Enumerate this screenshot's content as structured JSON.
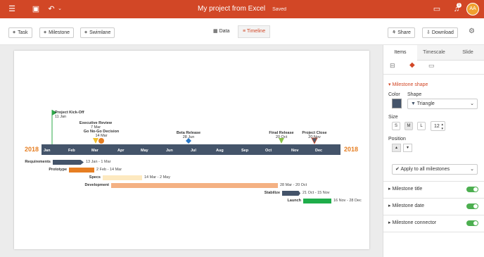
{
  "app": {
    "title": "My project from Excel",
    "status": "Saved",
    "avatar": "AA",
    "notifications": "1"
  },
  "toolbar": {
    "task": "Task",
    "milestone": "Milestone",
    "swimlane": "Swimlane",
    "data": "Data",
    "timeline": "Timeline",
    "share": "Share",
    "download": "Download"
  },
  "timeline": {
    "year_left": "2018",
    "year_right": "2018",
    "months": [
      "Jan",
      "Feb",
      "Mar",
      "Apr",
      "May",
      "Jun",
      "Jul",
      "Aug",
      "Sep",
      "Oct",
      "Nov",
      "Dec"
    ],
    "milestones": [
      {
        "name": "Project Kick-Off",
        "date": "11 Jan",
        "color": "#2ea84a",
        "shape": "flag"
      },
      {
        "name": "Executive Review",
        "date": "7 Mar",
        "color": "#f2c12e",
        "shape": "triangle"
      },
      {
        "name": "Go No-Go Decision",
        "date": "14 Mar",
        "color": "#e67e22",
        "shape": "circle"
      },
      {
        "name": "Beta Release",
        "date": "28 Jun",
        "color": "#2878c8",
        "shape": "diamond"
      },
      {
        "name": "Final Release",
        "date": "20 Oct",
        "color": "#8bc34a",
        "shape": "triangle"
      },
      {
        "name": "Project Close",
        "date": "20 Nov",
        "color": "#555f6d",
        "shape": "triangle"
      }
    ],
    "tasks": [
      {
        "name": "Requirements",
        "dates": "13 Jan - 1 Mar",
        "color": "#44546a"
      },
      {
        "name": "Prototype",
        "dates": "2 Feb - 14 Mar",
        "color": "#e67e22"
      },
      {
        "name": "Specs",
        "dates": "14 Mar - 2 May",
        "color": "#fde9c0"
      },
      {
        "name": "Development",
        "dates": "28 Mar - 20 Oct",
        "color": "#f4b183"
      },
      {
        "name": "Stabilize",
        "dates": "21 Oct - 15 Nov",
        "color": "#44546a"
      },
      {
        "name": "Launch",
        "dates": "16 Nov - 28 Dec",
        "color": "#1fad4a"
      }
    ]
  },
  "panel": {
    "tabs": [
      "Items",
      "Timescale",
      "Slide"
    ],
    "section": "Milestone shape",
    "color_label": "Color",
    "shape_label": "Shape",
    "shape_value": "Triangle",
    "shape_color": "#44546a",
    "size_label": "Size",
    "sizes": [
      "S",
      "M",
      "L"
    ],
    "size_num": "12",
    "position_label": "Position",
    "apply_label": "Apply to all milestones",
    "toggles": [
      {
        "label": "Milestone title"
      },
      {
        "label": "Milestone date"
      },
      {
        "label": "Milestone connector"
      }
    ]
  }
}
